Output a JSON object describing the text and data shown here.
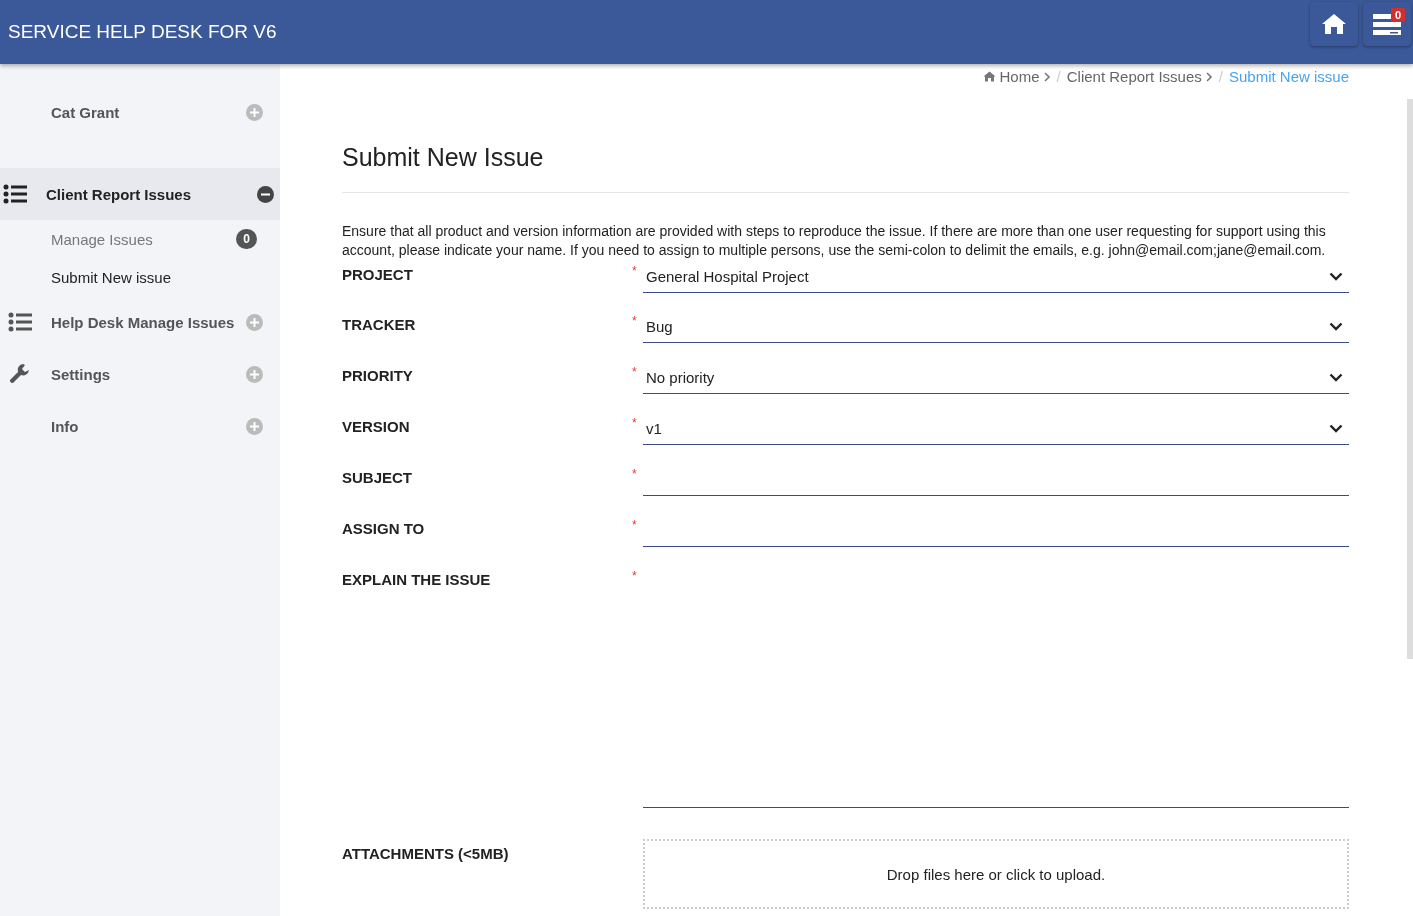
{
  "header": {
    "title": "SERVICE HELP DESK FOR V6",
    "buttons": [
      {
        "kind": "home"
      },
      {
        "kind": "tasks",
        "badge": "0"
      }
    ]
  },
  "sidebar": {
    "items": [
      {
        "label": "Cat Grant",
        "kind": "plain",
        "expanded": false,
        "selected": false
      },
      {
        "label": "Client Report Issues",
        "kind": "list",
        "expanded": true,
        "selected": true,
        "children": [
          {
            "label": "Manage Issues",
            "badge": "0",
            "selected": false
          },
          {
            "label": "Submit New issue",
            "selected": true
          }
        ]
      },
      {
        "label": "Help Desk Manage Issues",
        "kind": "list",
        "expanded": false,
        "selected": false
      },
      {
        "label": "Settings",
        "kind": "wrench",
        "expanded": false,
        "selected": false
      },
      {
        "label": "Info",
        "kind": "plain",
        "expanded": false,
        "selected": false
      }
    ]
  },
  "breadcrumb": {
    "separator": "/",
    "items": [
      {
        "label": "Home",
        "selected": false
      },
      {
        "label": "Client Report Issues",
        "selected": false
      },
      {
        "label": "Submit New issue",
        "selected": true
      }
    ]
  },
  "page": {
    "title": "Submit New Issue",
    "intro": "Ensure that all product and version information are provided with steps to reproduce the issue. If there are more than one user requesting for support using this account, please indicate your name. If you need to assign to multiple persons, use the semi-colon to delimit the emails, e.g. john@email.com;jane@email.com.",
    "required_mark": "*",
    "fields": [
      {
        "label": "PROJECT",
        "kind": "select",
        "required": true,
        "value": "General Hospital Project"
      },
      {
        "label": "TRACKER",
        "kind": "select",
        "required": true,
        "value": "Bug"
      },
      {
        "label": "PRIORITY",
        "kind": "select",
        "required": true,
        "value": "No priority"
      },
      {
        "label": "VERSION",
        "kind": "select",
        "required": true,
        "value": "v1"
      },
      {
        "label": "SUBJECT",
        "kind": "text",
        "required": true
      },
      {
        "label": "ASSIGN TO",
        "kind": "text",
        "required": true
      },
      {
        "label": "EXPLAIN THE ISSUE",
        "kind": "textarea",
        "required": true
      },
      {
        "label": "ATTACHMENTS (<5MB)",
        "kind": "dropzone",
        "required": false,
        "value": "Drop files here or click to upload."
      }
    ]
  }
}
